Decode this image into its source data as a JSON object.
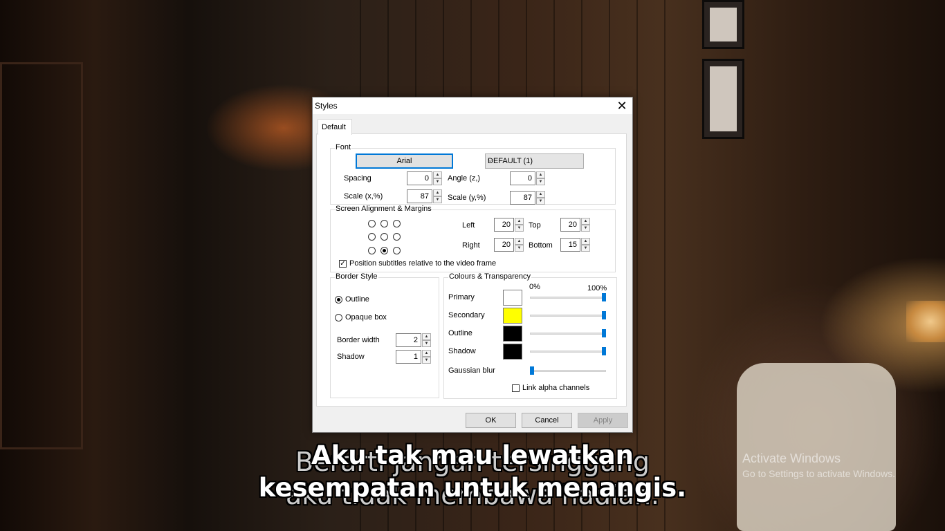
{
  "dialog": {
    "title": "Styles",
    "close_symbol": "✕",
    "tab_label": "Default",
    "font_group": {
      "legend": "Font",
      "font_button": "Arial",
      "charset_value": "DEFAULT (1)",
      "spacing_label": "Spacing",
      "spacing_value": "0",
      "angle_label": "Angle (z,)",
      "angle_value": "0",
      "scale_x_label": "Scale (x,%)",
      "scale_x_value": "87",
      "scale_y_label": "Scale (y,%)",
      "scale_y_value": "87"
    },
    "alignment_group": {
      "legend": "Screen Alignment & Margins",
      "selected_position": "bottom-center",
      "left_label": "Left",
      "left_value": "20",
      "top_label": "Top",
      "top_value": "20",
      "right_label": "Right",
      "right_value": "20",
      "bottom_label": "Bottom",
      "bottom_value": "15",
      "relative_checkbox_label": "Position subtitles relative to the video frame",
      "relative_checked": true
    },
    "border_group": {
      "legend": "Border Style",
      "outline_label": "Outline",
      "opaque_label": "Opaque box",
      "selected": "Outline",
      "border_width_label": "Border width",
      "border_width_value": "2",
      "shadow_label": "Shadow",
      "shadow_value": "1"
    },
    "colours_group": {
      "legend": "Colours & Transparency",
      "min_label": "0%",
      "max_label": "100%",
      "primary_label": "Primary",
      "primary_color": "#ffffff",
      "primary_opacity": 1.0,
      "secondary_label": "Secondary",
      "secondary_color": "#ffff00",
      "secondary_opacity": 1.0,
      "outline_label": "Outline",
      "outline_color": "#000000",
      "outline_opacity": 1.0,
      "shadow_label": "Shadow",
      "shadow_color": "#000000",
      "shadow_opacity": 1.0,
      "blur_label": "Gaussian blur",
      "blur_value": 0.0,
      "link_alpha_label": "Link alpha channels",
      "link_alpha_checked": false
    },
    "buttons": {
      "ok": "OK",
      "cancel": "Cancel",
      "apply": "Apply"
    }
  },
  "subtitles": {
    "ghost_line1": "Berarti jangan tersinggung",
    "ghost_line2": "aku tidak membawa hadiah.",
    "line1": "Aku tak mau lewatkan",
    "line2": "kesempatan untuk menangis."
  },
  "watermark": {
    "title": "Activate Windows",
    "subtitle": "Go to Settings to activate Windows."
  }
}
